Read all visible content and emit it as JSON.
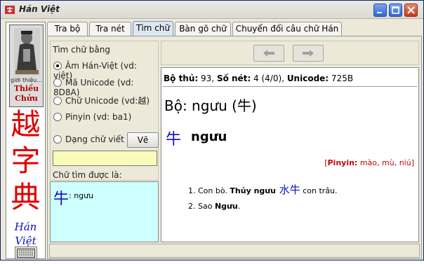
{
  "window": {
    "title": "Hán Việt",
    "minimize_icon": "minimize-icon",
    "maximize_icon": "maximize-icon",
    "close_icon": "close-icon"
  },
  "sidebar": {
    "portrait_caption": "giới thiệu...",
    "portrait_name_line1": "Thiều",
    "portrait_name_line2": "Chửu",
    "big_chars": [
      "越",
      "字",
      "典"
    ],
    "han_line1": "Hán",
    "han_line2": "Việt",
    "keyboard_icon": "keyboard-icon"
  },
  "tabs": [
    {
      "label": "Tra bộ",
      "active": false
    },
    {
      "label": "Tra nét",
      "active": false
    },
    {
      "label": "Tìm chữ",
      "active": true
    },
    {
      "label": "Bàn gõ chữ",
      "active": false
    },
    {
      "label": "Chuyển đổi câu chữ Hán",
      "active": false
    }
  ],
  "search": {
    "title": "Tìm chữ bằng",
    "options": [
      {
        "label": "Âm Hán-Việt (vd: việt)",
        "checked": true
      },
      {
        "label": "Mã Unicode (vd: 8D8A)",
        "checked": false
      },
      {
        "label": "Chữ Unicode (vd:越)",
        "checked": false
      },
      {
        "label": "Pinyin (vd: ba1)",
        "checked": false
      },
      {
        "label": "Dạng chữ viết",
        "checked": false
      }
    ],
    "draw_button": "Vẽ",
    "input_value": "",
    "found_label": "Chữ tìm được là:"
  },
  "result": {
    "char": "牛",
    "text": ": ngưu"
  },
  "nav": {
    "back_icon": "arrow-left-icon",
    "forward_icon": "arrow-right-icon"
  },
  "entry": {
    "info_bo_label": "Bộ thủ:",
    "info_bo_value": " 93,",
    "info_net_label": "Số nét:",
    "info_net_value": " 4 (4/0),",
    "info_uni_label": "Unicode:",
    "info_uni_value": " 725B",
    "radical_line": "Bộ: ngưu (牛)",
    "headword_char": "牛",
    "headword": "ngưu",
    "pinyin_open": "[",
    "pinyin_label": "Pinyin:",
    "pinyin_value": " mào, mù, niú",
    "pinyin_close": "]",
    "defs": [
      {
        "pre": "Con bò. ",
        "bold": "Thủy ngưu",
        "han": " 水牛",
        "post": " con trâu."
      },
      {
        "pre": "Sao ",
        "bold": "Ngưu",
        "han": "",
        "post": "."
      }
    ]
  },
  "colors": {
    "accent_red": "#e00000",
    "han_blue": "#1010c0",
    "result_bg": "#ceffff",
    "input_bg": "#fbfbb9"
  }
}
